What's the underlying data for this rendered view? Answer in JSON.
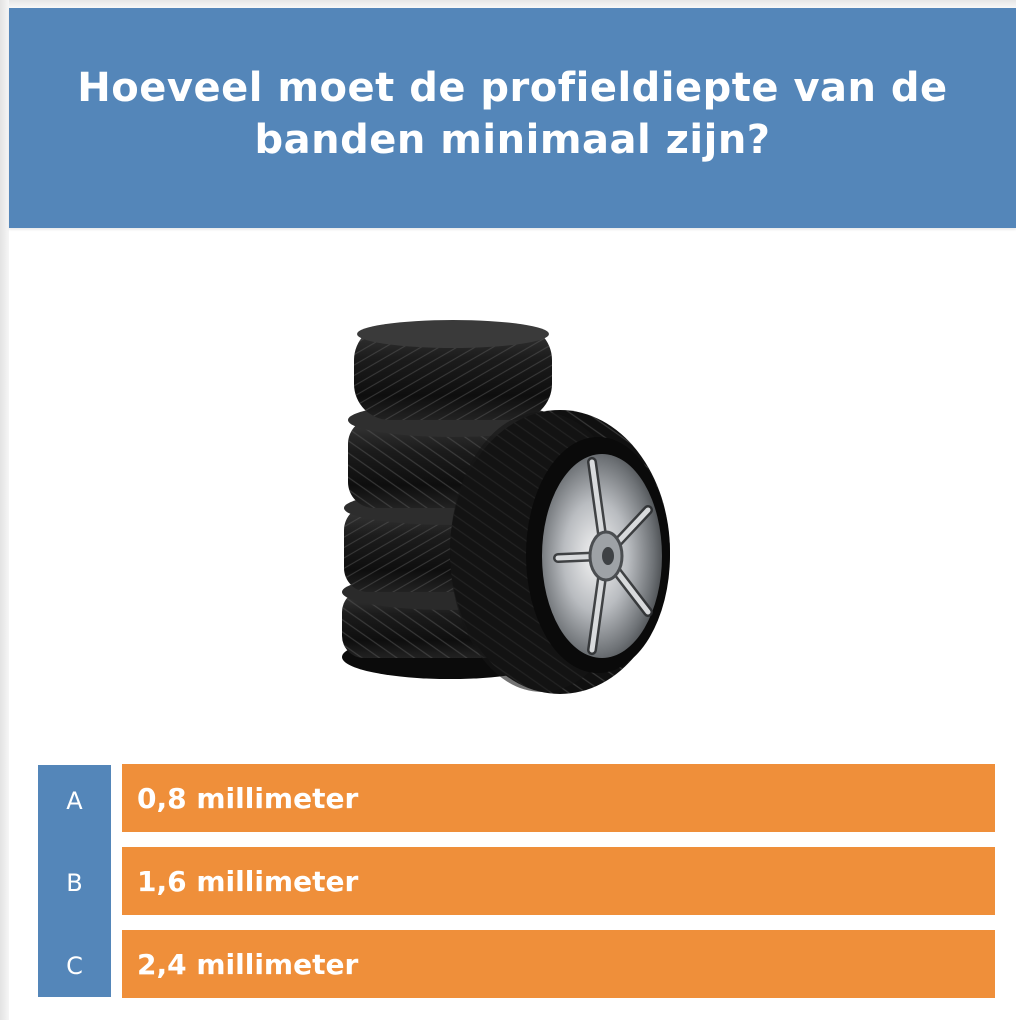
{
  "question": "Hoeveel moet de profieldiepte van de banden minimaal zijn?",
  "image": {
    "subject": "stack-of-car-tires-icon"
  },
  "options": [
    {
      "letter": "A",
      "text": "0,8 millimeter"
    },
    {
      "letter": "B",
      "text": "1,6 millimeter"
    },
    {
      "letter": "C",
      "text": "2,4 millimeter"
    }
  ],
  "colors": {
    "header": "#5486b9",
    "letter_column": "#5486b9",
    "option": "#ef8f3a",
    "text": "#ffffff"
  }
}
